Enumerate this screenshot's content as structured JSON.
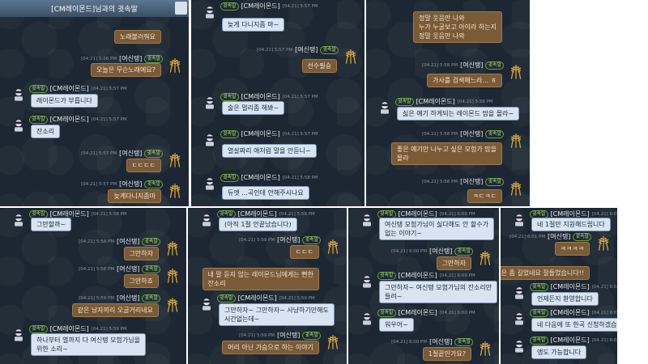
{
  "window_title": "[CM레이몬드]님과의 귓속말",
  "badge": "귓속말",
  "names": {
    "cm": "[CM레이몬드]",
    "user": "[여신탱]"
  },
  "panels": [
    {
      "items": [
        {
          "who": "user",
          "header": false,
          "text": "노래불러줘요"
        },
        {
          "who": "user",
          "header": true,
          "time": "[04.21] 5:56 PM",
          "text": "오늘은 무슨노래에요?"
        },
        {
          "who": "cm",
          "header": true,
          "time": "[04.21] 5:57 PM",
          "text": "레이몬드가 부릅니다"
        },
        {
          "who": "cm",
          "header": true,
          "time": "[04.21] 5:57 PM",
          "text": "잔소리"
        },
        {
          "who": "user",
          "header": true,
          "time": "[04.21] 5:57 PM",
          "text": "ㄷㄷㄷㄷ"
        },
        {
          "who": "user",
          "header": true,
          "time": "[04.21] 5:57 PM",
          "text": "늦게다니지좀마"
        }
      ]
    },
    {
      "items": [
        {
          "who": "cm",
          "header": true,
          "time": "[04.21] 5:57 PM",
          "text": "늦게 다니지좀 마~"
        },
        {
          "who": "user",
          "header": true,
          "time": "[04.21] 5:57 PM",
          "text": "선수필승"
        },
        {
          "who": "cm",
          "header": true,
          "time": "[04.21] 5:57 PM",
          "text": "술은 멀리좀 해봐~"
        },
        {
          "who": "cm",
          "header": true,
          "time": "[04.21] 5:57 PM",
          "text": "열살짜리 애처럼 말을 안듣니~"
        },
        {
          "who": "cm",
          "header": true,
          "time": "[04.21] 5:58 PM",
          "text": "듀엣 ...곡인데 안해주시나요"
        }
      ]
    },
    {
      "items": [
        {
          "who": "user",
          "header": false,
          "lines": [
            "정말 웃음만 나와",
            "누가 누굴보고 아이라 하는지",
            "정말 웃음만 나와"
          ]
        },
        {
          "who": "user",
          "header": true,
          "time": "[04.21] 5:58 PM",
          "text": "가사를 검색해느라... ㅎ"
        },
        {
          "who": "cm",
          "header": true,
          "time": "[04.21] 5:58 PM",
          "text": "싫은 얘기 하게되는 레이몬드 맘을 몰라~"
        },
        {
          "who": "user",
          "header": true,
          "time": "[04.21] 5:58 PM",
          "lines": [
            "좋은 얘기만 나누고 싶은 모험가 맘을",
            "몰라"
          ]
        },
        {
          "who": "user",
          "header": true,
          "time": "[04.21] 5:58 PM",
          "text": "ㅋㄷㅋㄷ"
        }
      ]
    },
    {
      "items": [
        {
          "who": "cm",
          "header": true,
          "time": "[04.21] 5:58 PM",
          "text": "그만할까~"
        },
        {
          "who": "user",
          "header": true,
          "time": "[04.21] 5:58 PM",
          "text": "그만하자"
        },
        {
          "who": "user",
          "header": true,
          "time": "[04.21] 5:58 PM",
          "text": "그만하죠"
        },
        {
          "who": "user",
          "header": true,
          "time": "[04.21] 5:59 PM",
          "text": "같은 남자끼리 오글거리네요"
        },
        {
          "who": "cm",
          "header": true,
          "time": "[04.21] 5:59 PM",
          "lines": [
            "하나부터 열까지 다 여신탱 모험가님을",
            "위한 소리~"
          ]
        }
      ]
    },
    {
      "items": [
        {
          "who": "cm",
          "header": true,
          "time": "[04.21] 5:59 PM",
          "text": "(아직 1절 안끝났습니다)"
        },
        {
          "who": "user",
          "header": true,
          "time": "[04.21] 5:59 PM",
          "text": "ㄷㄷㄷ"
        },
        {
          "who": "user",
          "header": false,
          "lines": [
            "내 말 듣지 않는 레이몬드님에게는 뻔한",
            "잔소리"
          ]
        },
        {
          "who": "cm",
          "header": true,
          "time": "[04.21] 5:59 PM",
          "lines": [
            "그만하자~ 그만하자~ 사냥하기만해도",
            "시간없는데~"
          ]
        },
        {
          "who": "user",
          "header": true,
          "time": "[04.21] 5:59 PM",
          "text": "머리 아닌 가슴으로 하는 이야기"
        }
      ]
    },
    {
      "items": [
        {
          "who": "cm",
          "header": true,
          "time": "[04.21] 6:00 PM",
          "lines": [
            "여신탱 모험가님이 싫다해도 안 할수가",
            "없는 이야기~"
          ]
        },
        {
          "who": "user",
          "header": true,
          "time": "[04.21] 6:00 PM",
          "text": "그만하자"
        },
        {
          "who": "cm",
          "header": true,
          "time": "[04.21] 6:00 PM",
          "lines": [
            "그만하자~ 여신탱 모험가님의 잔소리만",
            "들려~"
          ]
        },
        {
          "who": "cm",
          "header": true,
          "time": "[04.21] 6:00 PM",
          "text": "워우어~"
        },
        {
          "who": "user",
          "header": true,
          "time": "[04.21] 6:00 PM",
          "text": "1절끝인가요?"
        }
      ]
    },
    {
      "items": [
        {
          "who": "cm",
          "header": true,
          "time": "[04.21] 6:01 PM",
          "text": "네 1절만 지원해드립니다"
        },
        {
          "who": "user",
          "header": true,
          "time": "[04.21] 6:01 PM",
          "text": "ㅋㅋㅋㅋ"
        },
        {
          "who": "user",
          "header": false,
          "text": "오늘은 좀 길었네요 잘들었습니다!!"
        },
        {
          "who": "cm",
          "header": true,
          "time": "[04.21] 6:01 PM",
          "text": "언제든지 환영합니다"
        },
        {
          "who": "cm",
          "header": true,
          "time": "[04.21] 6:02 PM",
          "text": "네 다음에 또 한곡 신청하겠습니다"
        },
        {
          "who": "cm",
          "header": true,
          "time": "[04.21] 6:02 PM",
          "text": "앵도 가능합니다"
        }
      ]
    }
  ]
}
